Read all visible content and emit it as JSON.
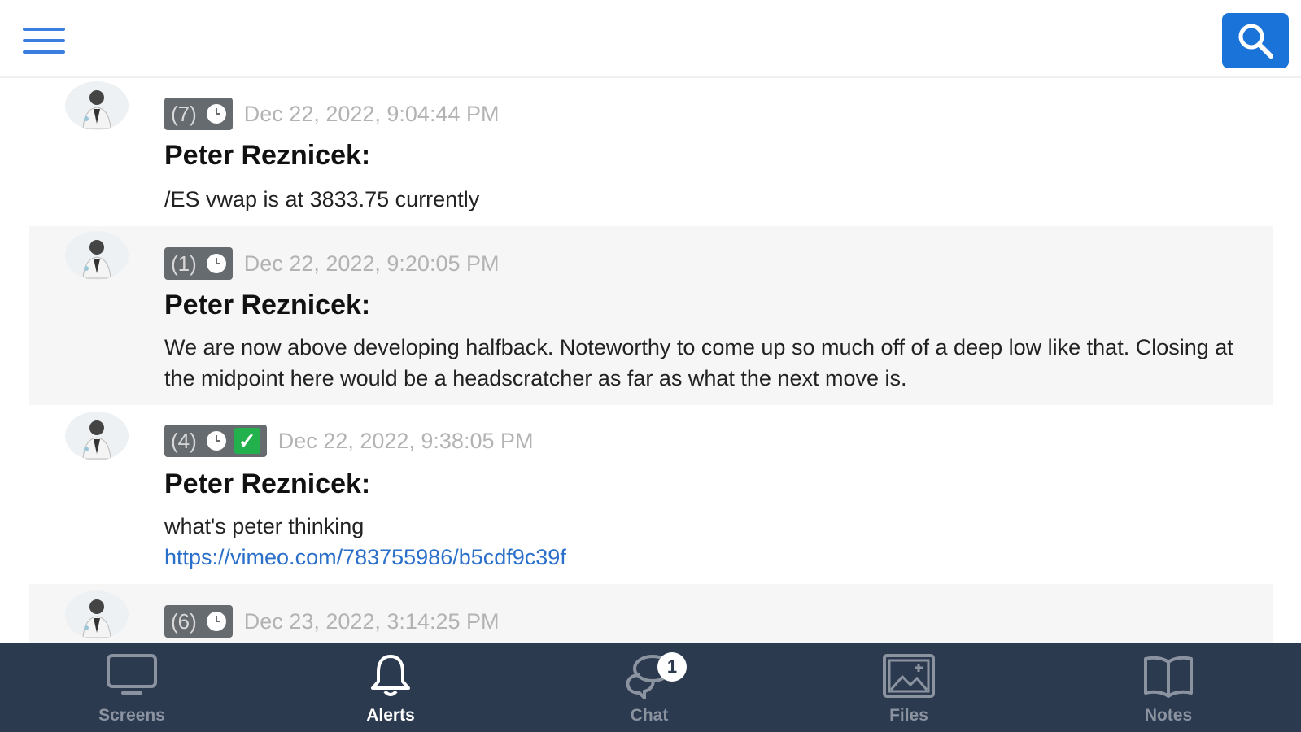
{
  "header": {
    "menu_icon": "hamburger-menu-icon",
    "search_icon": "search-icon",
    "accent_color": "#1a73d9"
  },
  "messages": [
    {
      "count": "(7)",
      "timestamp": "Dec 22, 2022, 9:04:44 PM",
      "author": "Peter Reznicek:",
      "text": "/ES vwap is at 3833.75 currently",
      "acknowledged": false
    },
    {
      "count": "(1)",
      "timestamp": "Dec 22, 2022, 9:20:05 PM",
      "author": "Peter Reznicek:",
      "text": "We are now above developing halfback. Noteworthy to come up so much off of a deep low like that. Closing at the midpoint here would be a headscratcher as far as what the next move is.",
      "acknowledged": false
    },
    {
      "count": "(4)",
      "timestamp": "Dec 22, 2022, 9:38:05 PM",
      "author": "Peter Reznicek:",
      "text": "what's peter thinking",
      "link": "https://vimeo.com/783755986/b5cdf9c39f",
      "acknowledged": true,
      "check_glyph": "✓"
    },
    {
      "count": "(6)",
      "timestamp": "Dec 23, 2022, 3:14:25 PM",
      "acknowledged": false
    }
  ],
  "tabs": [
    {
      "label": "Screens",
      "icon": "monitor-icon",
      "active": false
    },
    {
      "label": "Alerts",
      "icon": "bell-icon",
      "active": true
    },
    {
      "label": "Chat",
      "icon": "chat-bubbles-icon",
      "active": false,
      "badge": "1"
    },
    {
      "label": "Files",
      "icon": "image-gallery-icon",
      "active": false
    },
    {
      "label": "Notes",
      "icon": "open-book-icon",
      "active": false
    }
  ],
  "colors": {
    "tabbar_bg": "#2c3a50",
    "badge_bg": "#666b70",
    "timestamp": "#b3b3b3",
    "link": "#2a6fc9",
    "check": "#22b14c"
  }
}
